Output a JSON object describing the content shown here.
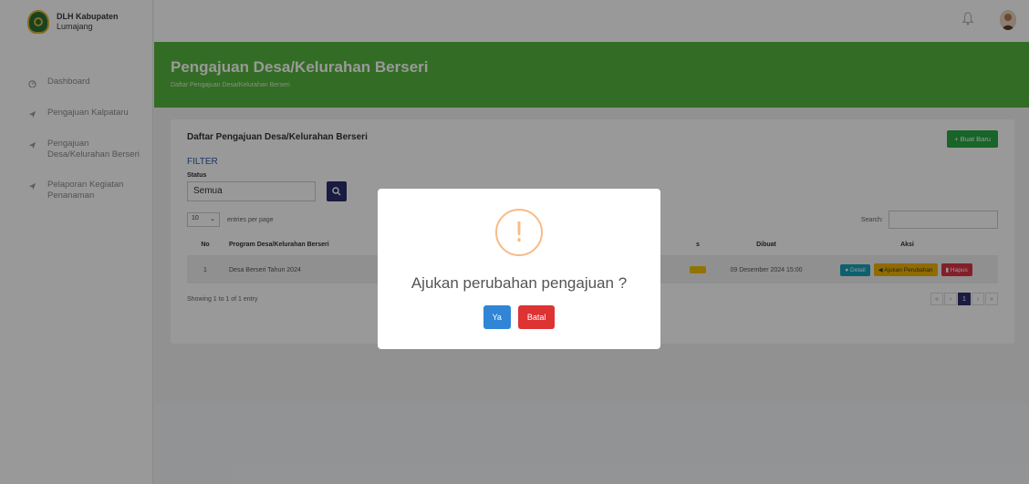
{
  "brand": {
    "line1": "DLH Kabupaten",
    "line2": "Lumajang"
  },
  "sidebar": {
    "items": [
      {
        "icon": "dashboard-icon",
        "label": "Dashboard"
      },
      {
        "icon": "send-icon",
        "label": "Pengajuan Kalpataru"
      },
      {
        "icon": "send-icon",
        "label": "Pengajuan Desa/Kelurahan Berseri"
      },
      {
        "icon": "send-icon",
        "label": "Pelaporan Kegiatan Penanaman"
      }
    ]
  },
  "header": {
    "title": "Pengajuan Desa/Kelurahan Berseri",
    "subtitle": "Daftar Pengajuan Desa/Kelurahan Berseri"
  },
  "card": {
    "title": "Daftar Pengajuan Desa/Kelurahan Berseri",
    "new_button": "+ Buat Baru",
    "filter_title": "FILTER",
    "status_label": "Status",
    "status_value": "Semua",
    "entries_value": "10",
    "entries_label": "entries per page",
    "search_label": "Search:"
  },
  "table": {
    "headers": [
      "No",
      "Program Desa/Kelurahan Berseri",
      "",
      "s",
      "Dibuat",
      "Aksi"
    ],
    "rows": [
      {
        "no": "1",
        "program": "Desa Berseri Tahun 2024",
        "status": "",
        "dibuat": "09 Desember 2024 15:00"
      }
    ],
    "actions": {
      "detail": "Detail",
      "ajukan": "Ajukan Perubahan",
      "hapus": "Hapus"
    }
  },
  "footer": {
    "showing": "Showing 1 to 1 of 1 entry",
    "pages": [
      "«",
      "‹",
      "1",
      "›",
      "»"
    ]
  },
  "modal": {
    "icon": "!",
    "title": "Ajukan perubahan pengajuan ?",
    "confirm": "Ya",
    "cancel": "Batal"
  },
  "colors": {
    "header_green": "#56b43c",
    "primary_navy": "#2c2e6b",
    "confirm_blue": "#3085d6",
    "cancel_red": "#dd3333",
    "warning_orange": "#f8bb86"
  }
}
